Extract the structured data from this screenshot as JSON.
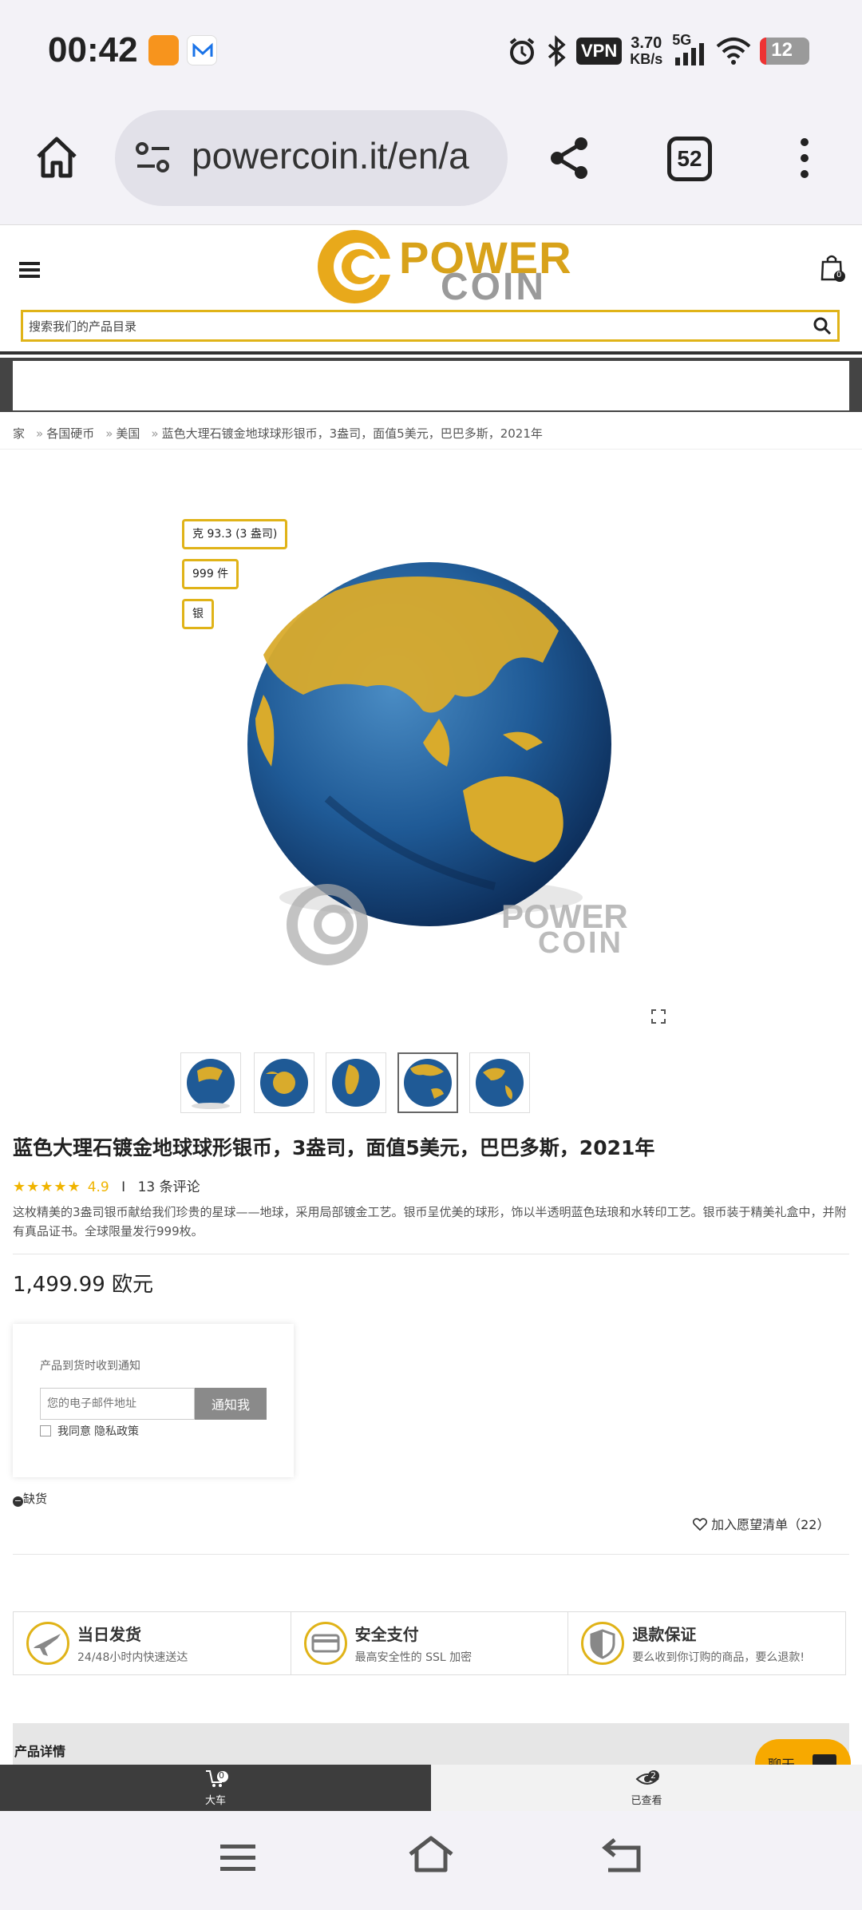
{
  "status": {
    "time": "00:42",
    "vpn": "VPN",
    "speed_value": "3.70",
    "speed_unit": "KB/s",
    "network": "5G",
    "battery": "12"
  },
  "browser": {
    "url": "powercoin.it/en/a",
    "tab_count": "52"
  },
  "site": {
    "logo_line1": "POWER",
    "logo_line2": "COIN",
    "search_placeholder": "搜索我们的产品目录",
    "cart_count": "0"
  },
  "breadcrumb": [
    "家",
    "各国硬币",
    "美国",
    "蓝色大理石镀金地球球形银币，3盎司，面值5美元，巴巴多斯，2021年"
  ],
  "image_tags": [
    "克 93.3 (3 盎司)",
    "999 件",
    "银"
  ],
  "watermark": {
    "line1": "POWER",
    "line2": "COIN"
  },
  "product": {
    "title": "蓝色大理石镀金地球球形银币，3盎司，面值5美元，巴巴多斯，2021年",
    "stars": "★★★★★",
    "rating": "4.9",
    "divider": "I",
    "reviews": "13 条评论",
    "description": "这枚精美的3盎司银币献给我们珍贵的星球——地球，采用局部镀金工艺。银币呈优美的球形，饰以半透明蓝色珐琅和水转印工艺。银币装于精美礼盒中，并附有真品证书。全球限量发行999枚。",
    "price": "1,499.99 欧元",
    "notify_label": "产品到货时收到通知",
    "email_placeholder": "您的电子邮件地址",
    "notify_button": "通知我",
    "agree_text": "我同意",
    "privacy_link": "隐私政策",
    "availability": "缺货",
    "wishlist": "加入愿望清单（22）"
  },
  "features": [
    {
      "title": "当日发货",
      "subtitle": "24/48小时内快速送达",
      "icon": "airplane-icon"
    },
    {
      "title": "安全支付",
      "subtitle": "最高安全性的 SSL 加密",
      "icon": "credit-card-icon"
    },
    {
      "title": "退款保证",
      "subtitle": "要么收到你订购的商品，要么退款!",
      "icon": "shield-icon"
    }
  ],
  "details_label": "产品详情",
  "chat_label": "聊天",
  "bottom_nav": {
    "cart_label": "大车",
    "cart_count": "0",
    "viewed_label": "已查看",
    "viewed_count": "2"
  },
  "colors": {
    "accent_gold": "#e0b318",
    "chat_orange": "#f7a900",
    "dark_nav": "#3d3d3d"
  }
}
